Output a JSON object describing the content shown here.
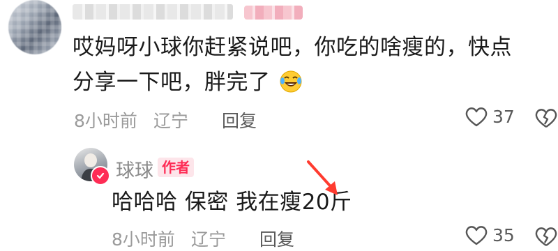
{
  "comment": {
    "text_line1": "哎妈呀小球你赶紧说吧，你吃的啥瘦的，快点",
    "text_line2": "分享一下吧，胖完了",
    "emoji_icon": "laughing-tears-emoji",
    "time": "8小时前",
    "location": "辽宁",
    "reply_label": "回复",
    "likes": "37"
  },
  "reply": {
    "username": "球球",
    "author_badge": "作者",
    "text": "哈哈哈 保密 我在瘦20斤",
    "time": "8小时前",
    "location": "辽宁",
    "reply_label": "回复",
    "likes": "35"
  },
  "colors": {
    "accent": "#fe2c55",
    "arrow": "#ff3b2f",
    "meta_gray": "#9a9a9a"
  }
}
